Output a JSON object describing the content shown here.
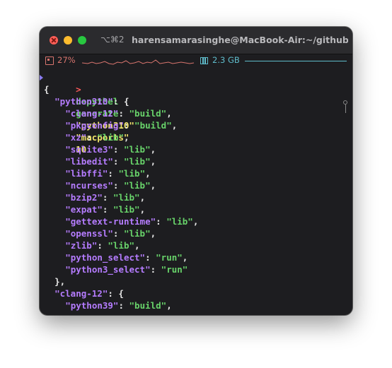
{
  "window": {
    "shortcut": "⌥⌘2",
    "title": "harensamarasinghe@MacBook-Air:~/github/d..."
  },
  "status": {
    "cpu": "27%",
    "memory": "2.3 GB",
    "cpu_color": "#d9756e",
    "memory_color": "#5fbccb"
  },
  "terminal": {
    "prompt": ">",
    "command": "depythel",
    "subcommand": "generate",
    "arg1": "\"python310\"",
    "arg2": "\"macports\"",
    "arg3": "10",
    "open_brace": "{",
    "groups": [
      {
        "key": "\"python310\"",
        "entries": [
          {
            "key": "\"clang-12\"",
            "value": "\"build\""
          },
          {
            "key": "\"pkgconfig\"",
            "value": "\"build\""
          },
          {
            "key": "\"xz\"",
            "value": "\"lib\""
          },
          {
            "key": "\"sqlite3\"",
            "value": "\"lib\""
          },
          {
            "key": "\"libedit\"",
            "value": "\"lib\""
          },
          {
            "key": "\"libffi\"",
            "value": "\"lib\""
          },
          {
            "key": "\"ncurses\"",
            "value": "\"lib\""
          },
          {
            "key": "\"bzip2\"",
            "value": "\"lib\""
          },
          {
            "key": "\"expat\"",
            "value": "\"lib\""
          },
          {
            "key": "\"gettext-runtime\"",
            "value": "\"lib\""
          },
          {
            "key": "\"openssl\"",
            "value": "\"lib\""
          },
          {
            "key": "\"zlib\"",
            "value": "\"lib\""
          },
          {
            "key": "\"python_select\"",
            "value": "\"run\""
          },
          {
            "key": "\"python3_select\"",
            "value": "\"run\""
          }
        ],
        "close": "},"
      },
      {
        "key": "\"clang-12\"",
        "entries": [
          {
            "key": "\"python39\"",
            "value": "\"build\""
          }
        ]
      }
    ]
  },
  "icons": {
    "cpu": "cpu-chip-icon",
    "memory": "memory-module-icon",
    "scroll": "scroll-marker-icon"
  },
  "colors": {
    "key": "#b57cff",
    "string": "#68d36a",
    "argument": "#f1e46b",
    "prompt": "#ff5a5a"
  }
}
